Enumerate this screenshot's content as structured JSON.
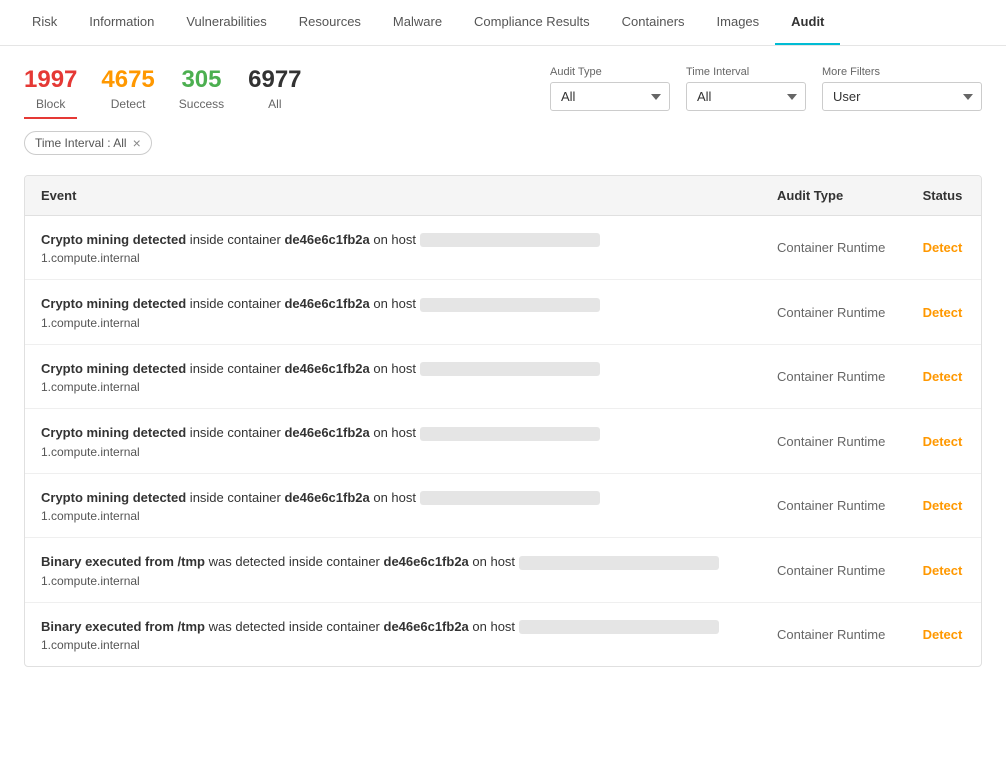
{
  "nav": {
    "tabs": [
      {
        "label": "Risk",
        "active": false
      },
      {
        "label": "Information",
        "active": false
      },
      {
        "label": "Vulnerabilities",
        "active": false
      },
      {
        "label": "Resources",
        "active": false
      },
      {
        "label": "Malware",
        "active": false
      },
      {
        "label": "Compliance Results",
        "active": false
      },
      {
        "label": "Containers",
        "active": false
      },
      {
        "label": "Images",
        "active": false
      },
      {
        "label": "Audit",
        "active": true
      }
    ]
  },
  "stats": {
    "block": {
      "value": "1997",
      "label": "Block",
      "class": "block"
    },
    "detect": {
      "value": "4675",
      "label": "Detect",
      "class": "detect"
    },
    "success": {
      "value": "305",
      "label": "Success",
      "class": "success"
    },
    "all": {
      "value": "6977",
      "label": "All",
      "class": "all"
    }
  },
  "filters": {
    "audit_type_label": "Audit Type",
    "audit_type_options": [
      "All"
    ],
    "audit_type_selected": "All",
    "time_interval_label": "Time Interval",
    "time_interval_options": [
      "All"
    ],
    "time_interval_selected": "All",
    "more_filters_label": "More Filters",
    "user_placeholder": "User"
  },
  "active_filter_tag": "Time Interval : All",
  "table": {
    "headers": [
      "Event",
      "Audit Type",
      "Status"
    ],
    "rows": [
      {
        "event_prefix": "Crypto mining detected",
        "event_mid": " inside container ",
        "event_container": "de46e6c1fb2a",
        "event_suffix": " on host ",
        "host": "1.compute.internal",
        "redacted_width": 180,
        "audit_type": "Container Runtime",
        "status": "Detect",
        "status_class": "status-detect"
      },
      {
        "event_prefix": "Crypto mining detected",
        "event_mid": " inside container ",
        "event_container": "de46e6c1fb2a",
        "event_suffix": " on host ",
        "host": "1.compute.internal",
        "redacted_width": 180,
        "audit_type": "Container Runtime",
        "status": "Detect",
        "status_class": "status-detect"
      },
      {
        "event_prefix": "Crypto mining detected",
        "event_mid": " inside container ",
        "event_container": "de46e6c1fb2a",
        "event_suffix": " on host ",
        "host": "1.compute.internal",
        "redacted_width": 180,
        "audit_type": "Container Runtime",
        "status": "Detect",
        "status_class": "status-detect"
      },
      {
        "event_prefix": "Crypto mining detected",
        "event_mid": " inside container ",
        "event_container": "de46e6c1fb2a",
        "event_suffix": " on host ",
        "host": "1.compute.internal",
        "redacted_width": 180,
        "audit_type": "Container Runtime",
        "status": "Detect",
        "status_class": "status-detect"
      },
      {
        "event_prefix": "Crypto mining detected",
        "event_mid": " inside container ",
        "event_container": "de46e6c1fb2a",
        "event_suffix": " on host ",
        "host": "1.compute.internal",
        "redacted_width": 180,
        "audit_type": "Container Runtime",
        "status": "Detect",
        "status_class": "status-detect"
      },
      {
        "event_prefix": "Binary executed from /tmp",
        "event_mid": " was detected inside container ",
        "event_container": "de46e6c1fb2a",
        "event_suffix": " on host ",
        "host": "1.compute.internal",
        "redacted_width": 200,
        "audit_type": "Container Runtime",
        "status": "Detect",
        "status_class": "status-detect"
      },
      {
        "event_prefix": "Binary executed from /tmp",
        "event_mid": " was detected inside container ",
        "event_container": "de46e6c1fb2a",
        "event_suffix": " on host ",
        "host": "1.compute.internal",
        "redacted_width": 200,
        "audit_type": "Container Runtime",
        "status": "Detect",
        "status_class": "status-detect"
      }
    ]
  }
}
